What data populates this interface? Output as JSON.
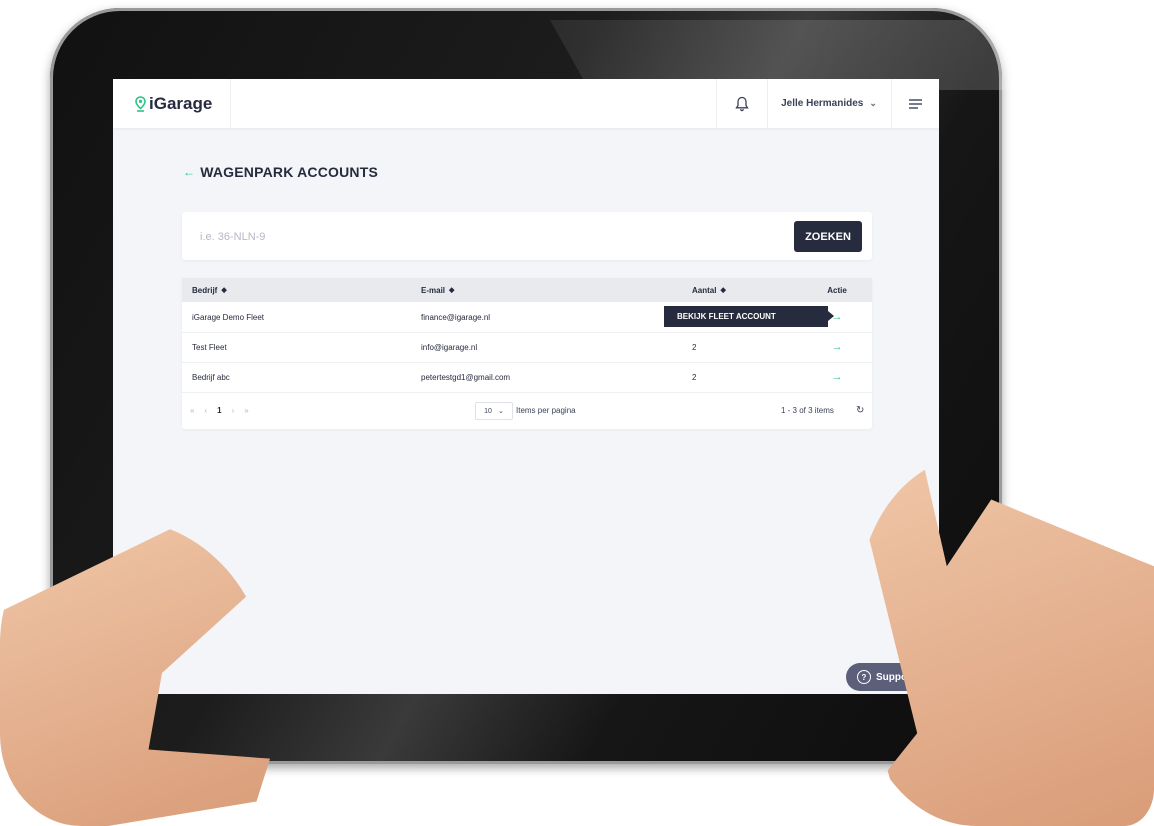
{
  "app": {
    "name": "iGarage"
  },
  "header": {
    "user_name": "Jelle Hermanides"
  },
  "page": {
    "title": "WAGENPARK ACCOUNTS"
  },
  "search": {
    "placeholder": "i.e. 36-NLN-9",
    "button_label": "ZOEKEN"
  },
  "table": {
    "columns": [
      "Bedrijf",
      "E-mail",
      "Aantal",
      "Actie"
    ],
    "rows": [
      {
        "bedrijf": "iGarage Demo Fleet",
        "email": "finance@igarage.nl",
        "aantal": ""
      },
      {
        "bedrijf": "Test Fleet",
        "email": "info@igarage.nl",
        "aantal": "2"
      },
      {
        "bedrijf": "Bedrijf abc",
        "email": "petertestgd1@gmail.com",
        "aantal": "2"
      }
    ],
    "tooltip": "BEKIJK FLEET ACCOUNT"
  },
  "pagination": {
    "current_page": "1",
    "per_page": "10",
    "per_page_label": "Items per pagina",
    "range": "1 - 3 of 3 items"
  },
  "support": {
    "label": "Support"
  },
  "colors": {
    "accent": "#2cc38a",
    "dark": "#262b3d",
    "support": "#5b5f7a"
  }
}
